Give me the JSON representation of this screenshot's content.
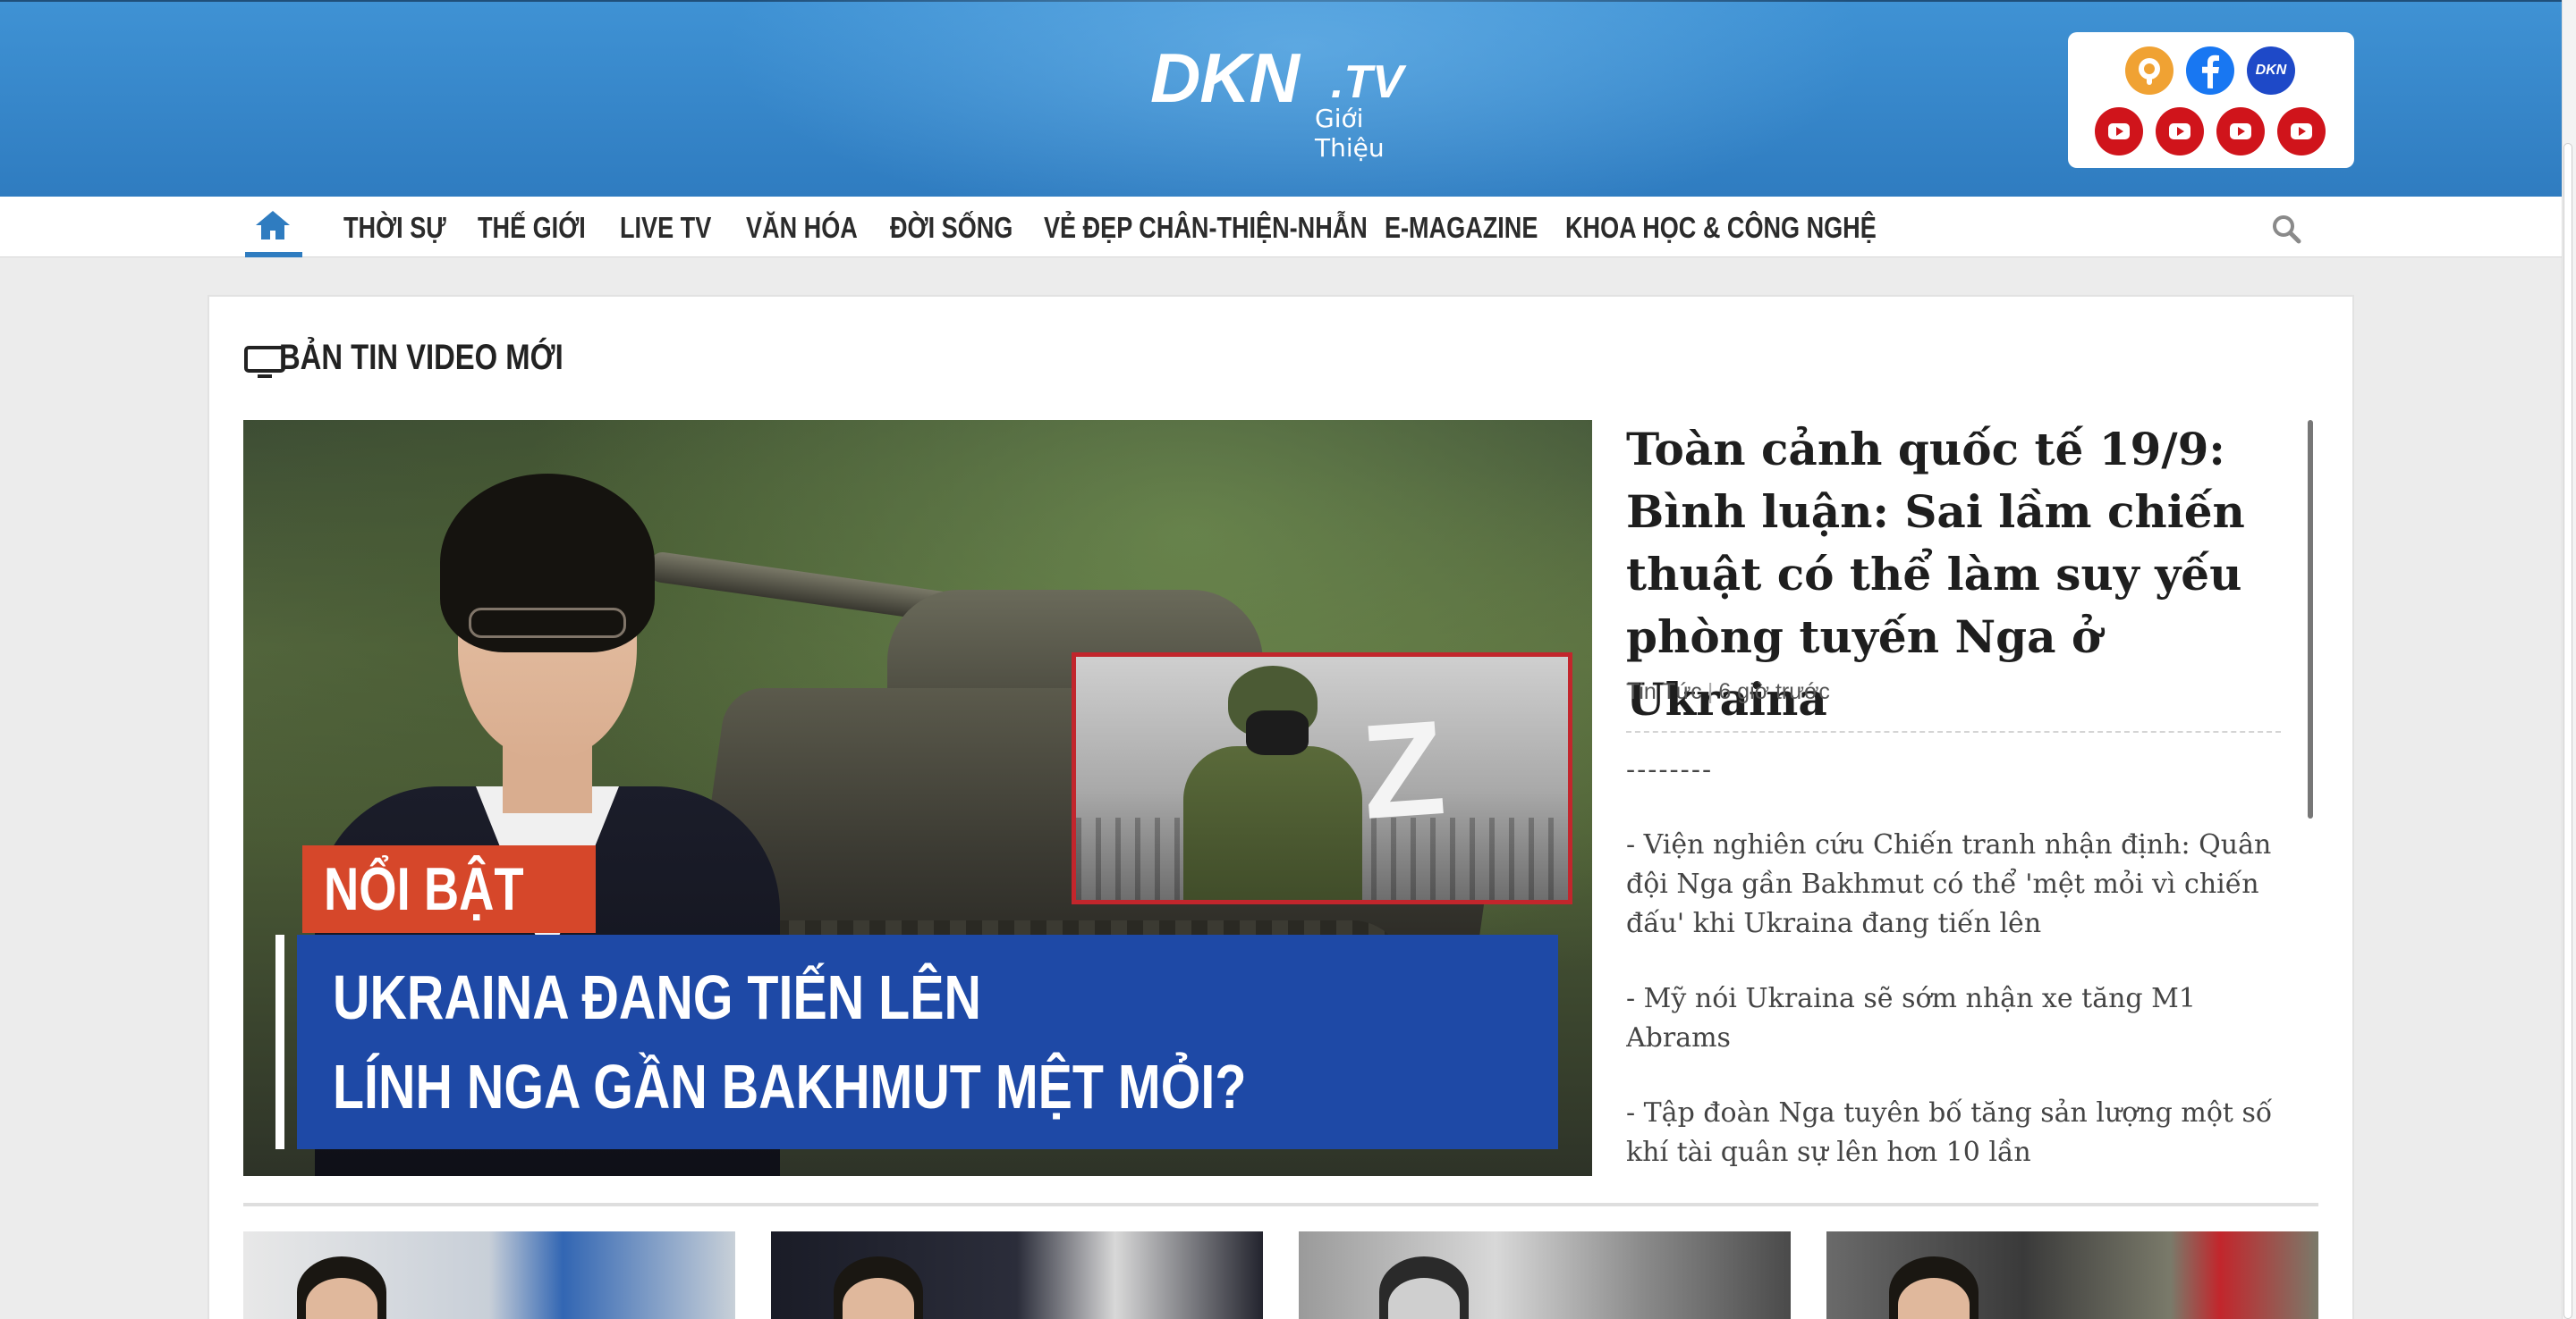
{
  "header": {
    "logo_main": "DKN",
    "logo_tld": ".TV",
    "logo_sub": "Giới Thiệu",
    "colors": {
      "header_blue": "#3f92d4",
      "youtube_red": "#d0141b",
      "facebook_blue": "#1877f2"
    },
    "social_icons": [
      "podcast-icon",
      "facebook-icon",
      "dkn-icon",
      "youtube-icon",
      "youtube-icon",
      "youtube-icon",
      "youtube-icon"
    ],
    "dkn_badge": "DKN"
  },
  "nav": {
    "items": [
      "THỜI SỰ",
      "THẾ GIỚI",
      "LIVE TV",
      "VĂN HÓA",
      "ĐỜI SỐNG",
      "VẺ ĐẸP CHÂN-THIỆN-NHẪN",
      "E-MAGAZINE",
      "KHOA HỌC & CÔNG NGHỆ"
    ]
  },
  "section": {
    "title": "BẢN TIN VIDEO MỚI"
  },
  "featured": {
    "image_tag": "NỔI BẬT",
    "image_line1": "UKRAINA ĐANG TIẾN LÊN",
    "image_line2": "LÍNH NGA GẦN BAKHMUT MỆT MỎI?",
    "image_inset_letter": "Z",
    "headline": "Toàn cảnh quốc tế 19/9: Bình luận: Sai lầm chiến thuật có thể làm suy yếu phòng tuyến Nga ở Ukraina",
    "category": "Tin Tức",
    "time": "6 giờ trước",
    "desc_dashes": "--------",
    "desc_items": [
      "- Viện nghiên cứu Chiến tranh nhận định: Quân đội Nga gần Bakhmut có thể 'mệt mỏi vì chiến đấu' khi Ukraina đang tiến lên",
      "- Mỹ nói Ukraina sẽ sớm nhận xe tăng M1 Abrams",
      "- Tập đoàn Nga tuyên bố tăng sản lượng một số khí tài quân sự lên hơn 10 lần"
    ]
  }
}
